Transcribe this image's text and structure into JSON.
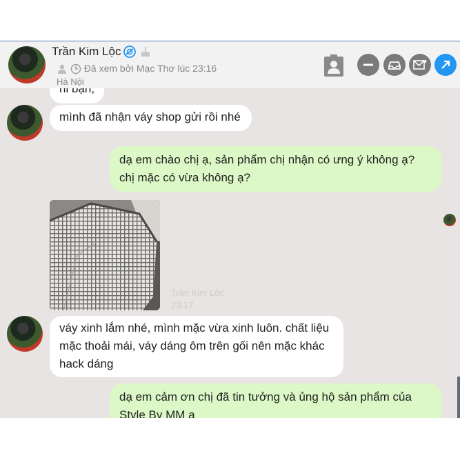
{
  "contact": {
    "name": "Trần Kim Lộc",
    "seen_status": "Đã xem bởi Mạc Thơ lúc 23:16",
    "location": "Hà Nội"
  },
  "header_buttons": [
    {
      "icon": "person-card-icon"
    },
    {
      "icon": "minus-icon"
    },
    {
      "icon": "inbox-icon"
    },
    {
      "icon": "mail-forward-icon"
    },
    {
      "icon": "arrow-up-right-icon"
    }
  ],
  "messages": [
    {
      "side": "in",
      "text": "hi bạn,"
    },
    {
      "side": "in",
      "text": "mình đã nhận váy shop gửi rồi nhé"
    },
    {
      "side": "out",
      "text": "dạ em chào chị ạ, sản phẩm chị nhận có ưng ý không ạ? chị mặc có vừa không ạ?"
    },
    {
      "side": "in",
      "type": "photo",
      "sender": "Trần Kim Lộc",
      "time": "23:17"
    },
    {
      "side": "in",
      "text": "váy xinh lắm nhé, mình mặc vừa xinh luôn. chất liệu mặc thoải mái, váy dáng ôm trên gối nên mặc khác hack dáng"
    },
    {
      "side": "out",
      "text": "dạ em cảm ơn chị đã tin tưởng và ủng hộ sản phẩm của Style By MM ạ"
    }
  ],
  "colors": {
    "incoming_bubble": "#ffffff",
    "outgoing_bubble": "#dcf8c6",
    "chat_background": "#e8e4e3",
    "accent": "#2196f3"
  }
}
